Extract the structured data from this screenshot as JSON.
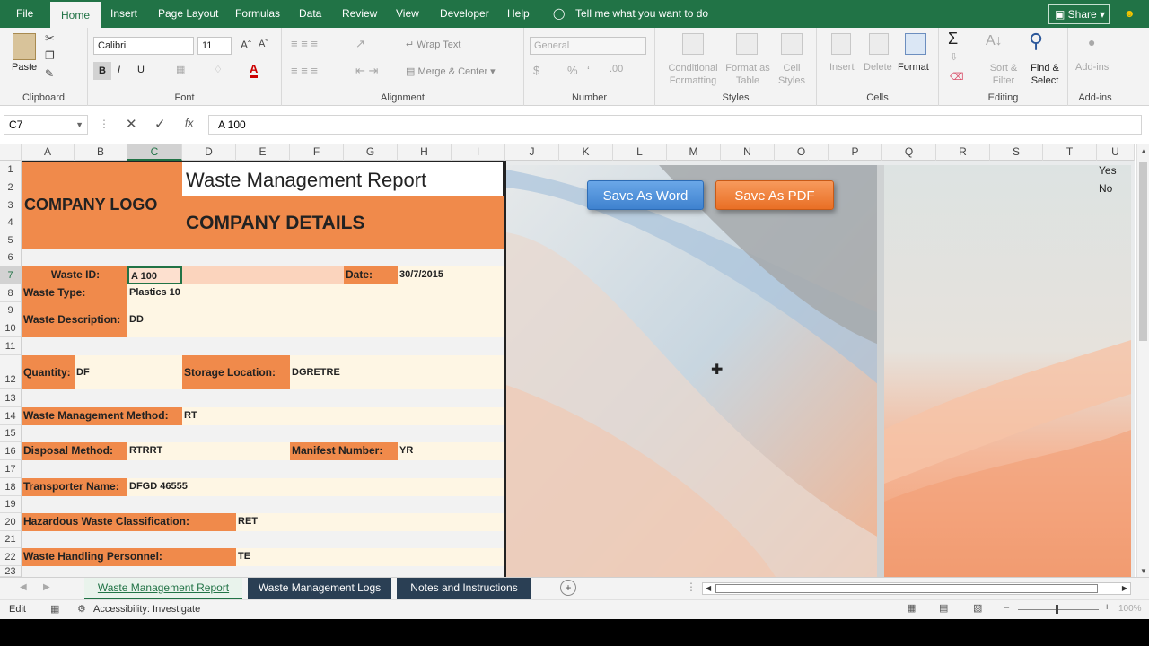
{
  "menu": {
    "tabs": [
      "File",
      "Home",
      "Insert",
      "Page Layout",
      "Formulas",
      "Data",
      "Review",
      "View",
      "Developer",
      "Help"
    ],
    "tell_me": "Tell me what you want to do",
    "share": "Share"
  },
  "ribbon": {
    "clipboard": {
      "paste": "Paste",
      "label": "Clipboard"
    },
    "font": {
      "name": "Calibri",
      "size": "11",
      "label": "Font",
      "bold": "B",
      "italic": "I",
      "underline": "U"
    },
    "alignment": {
      "wrap": "Wrap Text",
      "merge": "Merge & Center",
      "label": "Alignment"
    },
    "number": {
      "format": "General",
      "label": "Number",
      "percent": "%"
    },
    "styles": {
      "conditional": "Conditional Formatting",
      "format_table": "Format as Table",
      "cell_styles": "Cell Styles",
      "label": "Styles"
    },
    "cells": {
      "insert": "Insert",
      "delete": "Delete",
      "format": "Format",
      "label": "Cells"
    },
    "editing": {
      "sum": "Σ",
      "sort": "Sort & Filter",
      "find": "Find & Select",
      "label": "Editing"
    },
    "addins": {
      "addins": "Add-ins",
      "label": "Add-ins"
    }
  },
  "formula_bar": {
    "name_box": "C7",
    "content": "A 100",
    "fx": "fx"
  },
  "columns": [
    "A",
    "B",
    "C",
    "D",
    "E",
    "F",
    "G",
    "H",
    "I",
    "J",
    "K",
    "L",
    "M",
    "N",
    "O",
    "P",
    "Q",
    "R",
    "S",
    "T",
    "U"
  ],
  "rows": [
    "1",
    "2",
    "3",
    "4",
    "5",
    "6",
    "7",
    "8",
    "9",
    "10",
    "11",
    "12",
    "13",
    "14",
    "15",
    "16",
    "17",
    "18",
    "19",
    "20",
    "21",
    "22",
    "23"
  ],
  "report": {
    "logo": "COMPANY LOGO",
    "title": "Waste Management Report",
    "details": "COMPANY DETAILS",
    "waste_id_label": "Waste ID:",
    "waste_id": "A 100",
    "date_label": "Date:",
    "date": "30/7/2015",
    "waste_type_label": "Waste Type:",
    "waste_type": "Plastics 10",
    "description_label": "Waste Description:",
    "description": "DD",
    "quantity_label": "Quantity:",
    "quantity": "DF",
    "storage_label": "Storage Location:",
    "storage": "DGRETRE",
    "method_label": "Waste Management Method:",
    "method": "RT",
    "disposal_label": "Disposal Method:",
    "disposal": "RTRRT",
    "manifest_label": "Manifest Number:",
    "manifest": "YR",
    "transporter_label": "Transporter Name:",
    "transporter": "DFGD 46555",
    "hazard_label": "Hazardous Waste Classification:",
    "hazard": "RET",
    "personnel_label": "Waste Handling Personnel:",
    "personnel": "TE"
  },
  "buttons": {
    "save_word": "Save As Word",
    "save_pdf": "Save As PDF"
  },
  "side_list": [
    "Yes",
    "No"
  ],
  "sheet_tabs": [
    "Waste Management Report",
    "Waste Management Logs",
    "Notes and Instructions"
  ],
  "status": {
    "mode": "Edit",
    "accessibility": "Accessibility: Investigate",
    "zoom": "100%"
  },
  "colors": {
    "excel_green": "#217346",
    "orange": "#f08a4b",
    "cream": "#fef6e4",
    "word_blue": "#4a90d9",
    "pdf_orange": "#ef7a30"
  }
}
